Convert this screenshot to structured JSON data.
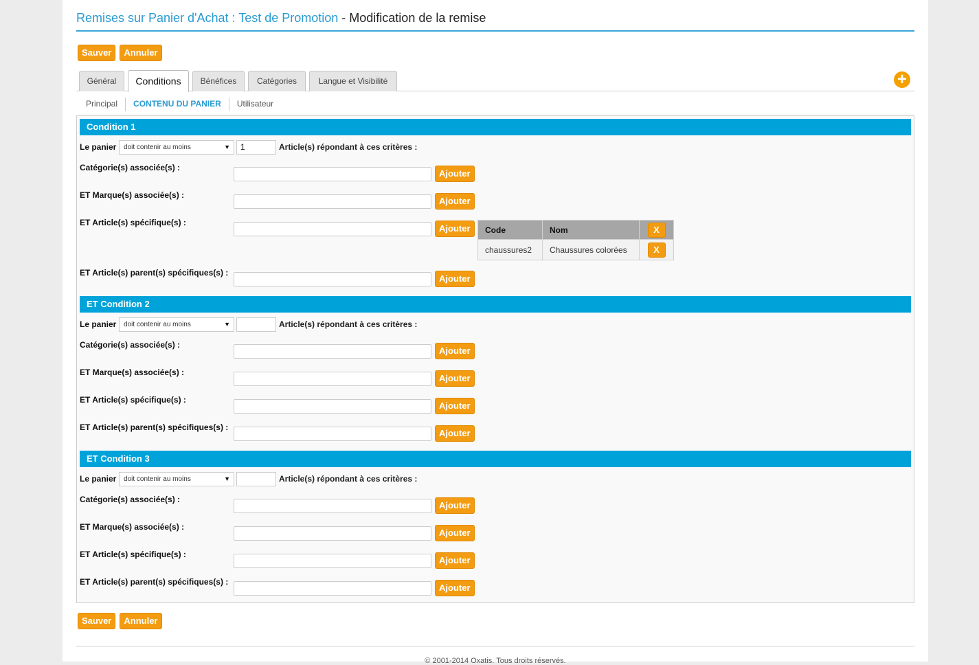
{
  "title": {
    "link": "Remises sur Panier d'Achat : Test de Promotion",
    "rest": " - Modification de la remise"
  },
  "actions": {
    "save": "Sauver",
    "cancel": "Annuler"
  },
  "tabs": [
    {
      "label": "Général"
    },
    {
      "label": "Conditions"
    },
    {
      "label": "Bénéfices"
    },
    {
      "label": "Catégories"
    },
    {
      "label": "Langue et Visibilité"
    }
  ],
  "subtabs": [
    {
      "label": "Principal"
    },
    {
      "label": "CONTENU DU PANIER"
    },
    {
      "label": "Utilisateur"
    }
  ],
  "labels": {
    "cart": "Le panier",
    "criteria": "Article(s) répondant à ces critères :",
    "categories": "Catégorie(s) associée(s) :",
    "brands": "ET Marque(s) associée(s) :",
    "articles": "ET Article(s) spécifique(s) :",
    "parents": "ET Article(s) parent(s) spécifiques(s) :",
    "add": "Ajouter"
  },
  "conditions": [
    {
      "title": "Condition 1",
      "selected": "doit contenir au moins",
      "qty": "1"
    },
    {
      "title": "ET Condition 2",
      "selected": "doit contenir au moins",
      "qty": ""
    },
    {
      "title": "ET Condition 3",
      "selected": "doit contenir au moins",
      "qty": ""
    }
  ],
  "article_table": {
    "columns": [
      "Code",
      "Nom"
    ],
    "rows": [
      {
        "code": "chaussures2",
        "name": "Chaussures colorées"
      }
    ],
    "remove_label": "X"
  },
  "footer": "© 2001-2014 Oxatis. Tous droits réservés.",
  "colors": {
    "accent": "#f39c12",
    "header": "#00a3d9",
    "link": "#2a9bd2"
  },
  "icons": {
    "add": "plus-circle-icon",
    "dropdown": "triangle-down-icon"
  }
}
